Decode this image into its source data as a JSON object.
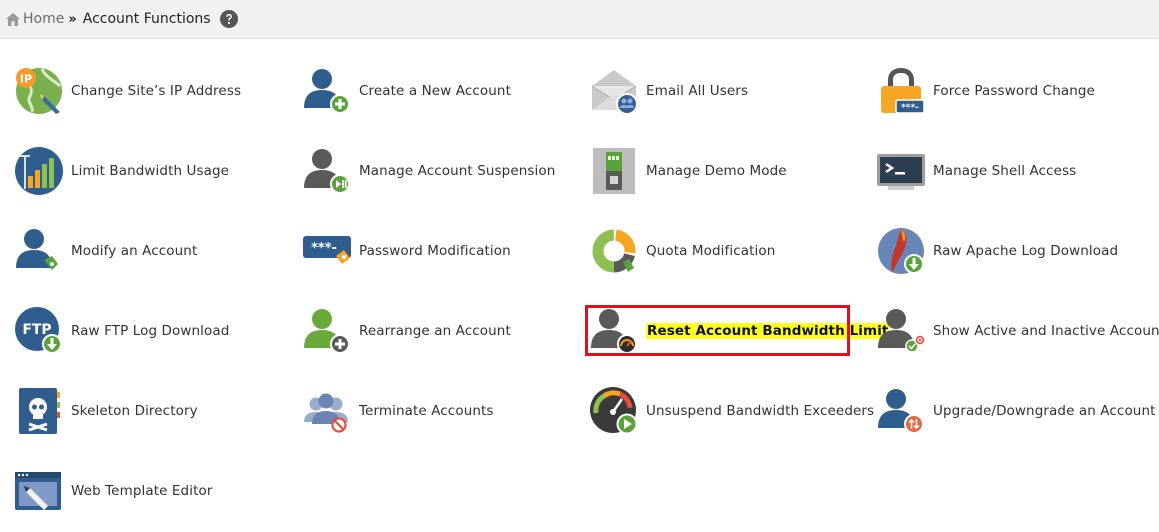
{
  "breadcrumb": {
    "home": "Home",
    "separator": "»",
    "current": "Account Functions"
  },
  "items": [
    {
      "label": "Change Site’s IP Address",
      "icon": "ip-globe-icon"
    },
    {
      "label": "Create a New Account",
      "icon": "user-add-icon"
    },
    {
      "label": "Email All Users",
      "icon": "email-users-icon"
    },
    {
      "label": "Force Password Change",
      "icon": "padlock-password-icon"
    },
    {
      "label": "Limit Bandwidth Usage",
      "icon": "bandwidth-chart-icon"
    },
    {
      "label": "Manage Account Suspension",
      "icon": "user-suspend-icon"
    },
    {
      "label": "Manage Demo Mode",
      "icon": "demo-switch-icon"
    },
    {
      "label": "Manage Shell Access",
      "icon": "terminal-icon"
    },
    {
      "label": "Modify an Account",
      "icon": "user-edit-icon"
    },
    {
      "label": "Password Modification",
      "icon": "password-edit-icon"
    },
    {
      "label": "Quota Modification",
      "icon": "quota-pie-icon"
    },
    {
      "label": "Raw Apache Log Download",
      "icon": "apache-download-icon"
    },
    {
      "label": "Raw FTP Log Download",
      "icon": "ftp-download-icon"
    },
    {
      "label": "Rearrange an Account",
      "icon": "user-rearrange-icon"
    },
    {
      "label": "Reset Account Bandwidth Limit",
      "icon": "user-bandwidth-reset-icon"
    },
    {
      "label": "Show Active and Inactive Accounts",
      "icon": "user-status-icon"
    },
    {
      "label": "Skeleton Directory",
      "icon": "skull-folder-icon"
    },
    {
      "label": "Terminate Accounts",
      "icon": "users-terminate-icon"
    },
    {
      "label": "Unsuspend Bandwidth Exceeders",
      "icon": "gauge-play-icon"
    },
    {
      "label": "Upgrade/Downgrade an Account",
      "icon": "user-upgrade-icon"
    },
    {
      "label": "Web Template Editor",
      "icon": "web-template-icon"
    }
  ],
  "highlighted_item": "Reset Account Bandwidth Limit",
  "colors": {
    "highlight_border": "#e0101e",
    "highlight_fill": "#ffff1f",
    "breadcrumb_bg": "#f1f1f1"
  }
}
